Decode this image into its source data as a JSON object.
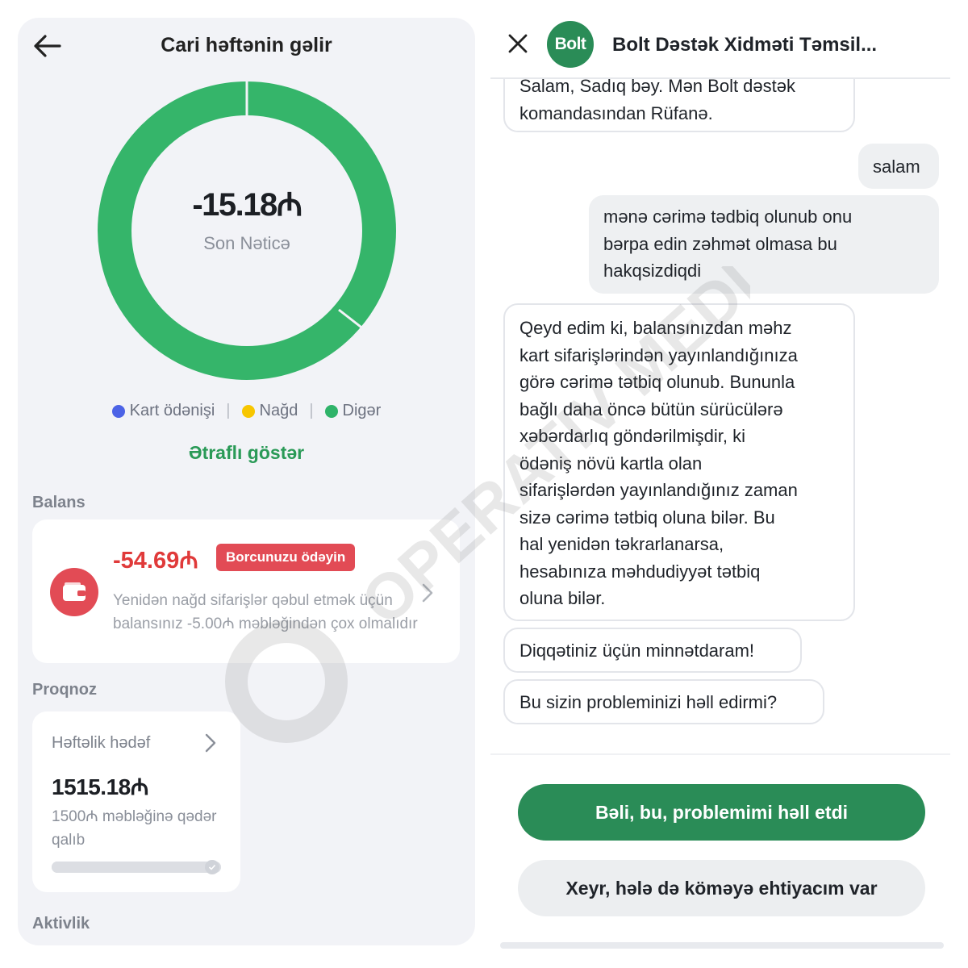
{
  "left": {
    "title": "Cari həftənin gəlir",
    "donut": {
      "value": "-15.18₼",
      "label": "Son Nəticə",
      "segments": [
        {
          "name": "Kart ödənişi",
          "color": "#3b5bdb",
          "fraction": 0.0
        },
        {
          "name": "Nağd",
          "color": "#f5c518",
          "fraction": 0.0
        },
        {
          "name": "Digər",
          "color": "#35b56a",
          "fraction": 1.0
        }
      ]
    },
    "legend": [
      {
        "label": "Kart ödənişi",
        "color": "#4c63e6"
      },
      {
        "label": "Nağd",
        "color": "#f7c600"
      },
      {
        "label": "Digər",
        "color": "#2fb369"
      }
    ],
    "more_link": "Ətraflı göstər",
    "balance_section": "Balans",
    "balance": {
      "amount": "-54.69₼",
      "badge": "Borcunuzu ödəyin",
      "description": "Yenidən nağd sifarişlər qəbul etmək üçün balansınız -5.00₼ məbləğindən çox olmalıdır"
    },
    "forecast_section": "Proqnoz",
    "forecast": {
      "label": "Həftəlik hədəf",
      "value": "1515.18₼",
      "description": "1500₼ məbləğinə qədər qalıb",
      "progress": 1.0
    },
    "activity_section": "Aktivlik"
  },
  "right": {
    "title": "Bolt Dəstək Xidməti Təmsil...",
    "logo_text": "Bolt",
    "messages": [
      {
        "from": "agent",
        "text": "Salam, Sadıq bəy. Mən Bolt dəstək\nkomandasından Rüfanə."
      },
      {
        "from": "user",
        "text": "salam"
      },
      {
        "from": "user",
        "text": "mənə cərimə tədbiq olunub onu\nbərpa edin zəhmət olmasa bu\nhakqsizdiqdi"
      },
      {
        "from": "agent",
        "text": "Qeyd edim ki, balansınızdan məhz\nkart sifarişlərindən yayınlandığınıza\ngörə cərimə tətbiq olunub. Bununla\nbağlı daha öncə bütün sürücülərə\nxəbərdarlıq göndərilmişdir, ki\nödəniş növü kartla olan\nsifarişlərdən yayınlandığınız zaman\nsizə cərimə tətbiq oluna bilər. Bu\nhal yenidən təkrarlanarsa,\nhesabınıza məhdudiyyət tətbiq\noluna bilər."
      },
      {
        "from": "agent",
        "text": "Diqqətiniz üçün minnətdaram!"
      },
      {
        "from": "agent",
        "text": "Bu sizin probleminizi həll edirmi?"
      }
    ],
    "buttons": {
      "yes": "Bəli, bu, problemimi həll etdi",
      "no": "Xeyr, hələ də köməyə ehtiyacım var"
    }
  },
  "colors": {
    "bolt_green": "#2a8c57",
    "donut_green": "#35b56a",
    "debt_red": "#e24b55"
  }
}
